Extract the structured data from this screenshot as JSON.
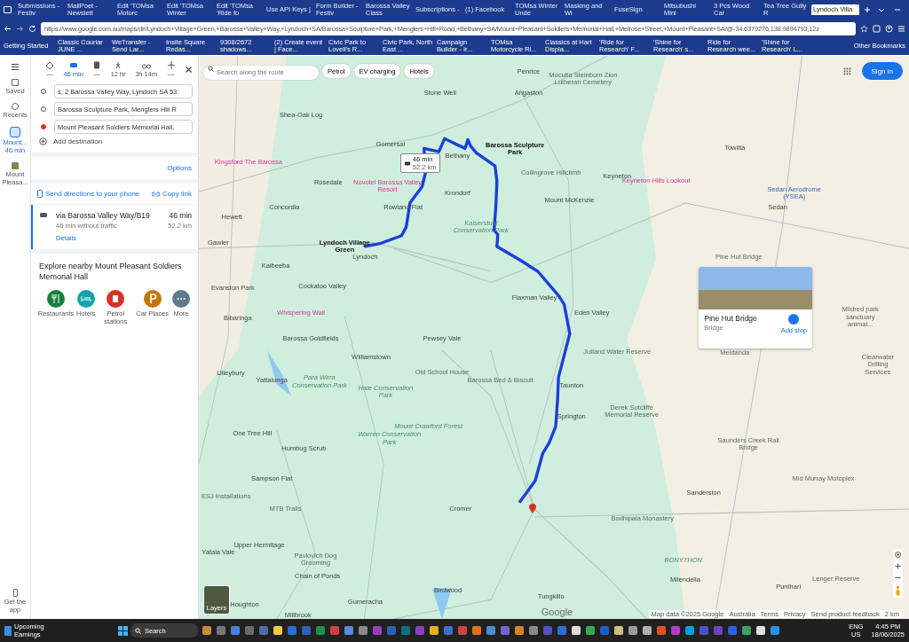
{
  "browser": {
    "tabs": [
      {
        "label": "Submissions - Festiv",
        "selected": false
      },
      {
        "label": "MailPoet - Newslett",
        "selected": false
      },
      {
        "label": "Edit 'TOMsa Motorc",
        "selected": false
      },
      {
        "label": "Edit 'TOMsa Winter",
        "selected": false
      },
      {
        "label": "Edit 'TOMsa 'Ride fo",
        "selected": false
      },
      {
        "label": "Use API Keys |",
        "selected": false
      },
      {
        "label": "Form Builder - Festiv",
        "selected": false
      },
      {
        "label": "Barossa Valley Class",
        "selected": false
      },
      {
        "label": "Subscriptions -",
        "selected": false
      },
      {
        "label": "(1) Facebook",
        "selected": false
      },
      {
        "label": "TOMsa Winter Unde",
        "selected": false
      },
      {
        "label": "Masking and Wi",
        "selected": false
      },
      {
        "label": "FuseSign",
        "selected": false
      },
      {
        "label": "Mitsubushi Mini",
        "selected": false
      },
      {
        "label": "3 Pcs Wood Car",
        "selected": false
      },
      {
        "label": "Tea Tree Gully R",
        "selected": false
      },
      {
        "label": "Lyndoch Villa",
        "selected": true
      }
    ],
    "url": "https://www.google.com.au/maps/dir/Lyndoch+Village+Green,+Barossa+Valley+Way,+Lyndoch+SA/Barossa+Sculpture+Park,+Menglers+Hill+Road,+Bethany+SA/Mount+Pleasant+Soldiers+Memorial+Hall,+Melrose+Street,+Mount+Pleasant+SA/@-34.6379276,138.9894793,12z",
    "bookmarks": [
      "Getting Started",
      "Classic Couriar JUNE ...",
      "WeTransfer - Send Lar...",
      "Insite Square Redas...",
      "9308/2672 shadows...",
      "(2) Create event | Face...",
      "Civic Park to Lovell's R...",
      "Civic Park, North East ...",
      "Campaign Builder - Ir...",
      "TOMsa Motorcycle Ri...",
      "Classics at Hart Displa...",
      "'Ride for Research' F...",
      "'Shine for Research' s...",
      "Ride for Research wee...",
      "'Shine for Research' L..."
    ],
    "other_bookmarks": "Other Bookmarks"
  },
  "rail": {
    "items": [
      {
        "kind": "saved",
        "label": "Saved",
        "selected": false
      },
      {
        "kind": "recents",
        "label": "Recents",
        "selected": false
      },
      {
        "kind": "route",
        "label": "Mount... 46 min",
        "selected": true
      },
      {
        "kind": "place",
        "label": "Mount Pleasa...",
        "selected": false
      }
    ],
    "get_app": "Get the app"
  },
  "directions": {
    "modes": [
      {
        "kind": "best",
        "label": "—",
        "selected": false
      },
      {
        "kind": "car",
        "label": "46 min",
        "selected": true
      },
      {
        "kind": "transit",
        "label": "—",
        "selected": false
      },
      {
        "kind": "walk",
        "label": "12 hr",
        "selected": false
      },
      {
        "kind": "bike",
        "label": "3h 14m",
        "selected": false
      },
      {
        "kind": "flight",
        "label": "—",
        "selected": false
      }
    ],
    "stops": [
      {
        "kind": "start",
        "value": "s, 2 Barossa Valley Way, Lyndoch SA 53:"
      },
      {
        "kind": "via",
        "value": "Barossa Sculpture Park, Menglers Hill R"
      },
      {
        "kind": "end",
        "value": "Mount Pleasant Soldiers Memorial Hall,"
      }
    ],
    "add_destination": "Add destination",
    "options": "Options",
    "send": "Send directions to your phone",
    "copy": "Copy link",
    "route": {
      "name": "via Barossa Valley Way/B19",
      "time": "46 min",
      "note": "46 min without traffic",
      "distance": "52.2 km",
      "details": "Details",
      "selected": true
    },
    "explore_title": "Explore nearby Mount Pleasant Soldiers Memorial Hall",
    "categories": [
      {
        "kind": "food",
        "label": "Restaurants",
        "color": "#188038"
      },
      {
        "kind": "bed",
        "label": "Hotels",
        "color": "#12a4af"
      },
      {
        "kind": "fuel",
        "label": "Petrol stations",
        "color": "#d93025"
      },
      {
        "kind": "parking",
        "label": "Car Places",
        "color": "#c5780a"
      },
      {
        "kind": "more",
        "label": "More",
        "color": "#5f7a8c"
      }
    ]
  },
  "map": {
    "search_placeholder": "Search along the route",
    "chips": [
      "Petrol",
      "EV charging",
      "Hotels"
    ],
    "sign_in": "Sign in",
    "route_badge": {
      "time": "46 min",
      "distance": "52.2 km"
    },
    "labels": [
      {
        "text": "Penrice",
        "kind": "place"
      },
      {
        "text": "Moculta Steinborn Zion Lutheran Cemetery",
        "kind": "landmark"
      },
      {
        "text": "Stone Well",
        "kind": "place"
      },
      {
        "text": "Angaston",
        "kind": "place"
      },
      {
        "text": "Shea-Oak Log",
        "kind": "place"
      },
      {
        "text": "Gomersal",
        "kind": "place"
      },
      {
        "text": "Bethany",
        "kind": "place"
      },
      {
        "text": "Barossa Sculpture Park",
        "kind": "stop"
      },
      {
        "text": "Towitta",
        "kind": "place"
      },
      {
        "text": "Kingsford The Barossa",
        "kind": "hotel"
      },
      {
        "text": "Rosedale",
        "kind": "place"
      },
      {
        "text": "Novotel Barossa Valley Resort",
        "kind": "hotel"
      },
      {
        "text": "Collingrove Hillclimb",
        "kind": "park"
      },
      {
        "text": "Keyneton",
        "kind": "place"
      },
      {
        "text": "Keyneton Hills Lookout",
        "kind": "hotel"
      },
      {
        "text": "Krondorf",
        "kind": "place"
      },
      {
        "text": "Mount McKenzie",
        "kind": "place"
      },
      {
        "text": "Sedan Aerodrome (YSEA)",
        "kind": "airport"
      },
      {
        "text": "Concordia",
        "kind": "place"
      },
      {
        "text": "Rowland Flat",
        "kind": "place"
      },
      {
        "text": "Sedan",
        "kind": "place"
      },
      {
        "text": "Hewett",
        "kind": "place"
      },
      {
        "text": "Kaiserstuhl Conservation Park",
        "kind": "area"
      },
      {
        "text": "Gawler",
        "kind": "place"
      },
      {
        "text": "Lyndoch Village Green",
        "kind": "stop"
      },
      {
        "text": "Lyndoch",
        "kind": "place"
      },
      {
        "text": "Pine Hut Bridge",
        "kind": "landmark"
      },
      {
        "text": "Kalbeeba",
        "kind": "place"
      },
      {
        "text": "Evanston Park",
        "kind": "place"
      },
      {
        "text": "Cockatoo Valley",
        "kind": "place"
      },
      {
        "text": "Flaxman Valley",
        "kind": "place"
      },
      {
        "text": "Bibaringa",
        "kind": "place"
      },
      {
        "text": "Whispering Wall",
        "kind": "hotel"
      },
      {
        "text": "Eden Valley",
        "kind": "place"
      },
      {
        "text": "Mildred park sanctuary animal...",
        "kind": "park"
      },
      {
        "text": "Barossa Goldfields",
        "kind": "place"
      },
      {
        "text": "Pewsey Vale",
        "kind": "place"
      },
      {
        "text": "Williamstown",
        "kind": "place"
      },
      {
        "text": "Jutland Water Reserve",
        "kind": "park"
      },
      {
        "text": "Meldanda",
        "kind": "park"
      },
      {
        "text": "Ulleybury",
        "kind": "place"
      },
      {
        "text": "Yattalunga",
        "kind": "place"
      },
      {
        "text": "Para Wirra Conservation Park",
        "kind": "area"
      },
      {
        "text": "Hale Conservation Park",
        "kind": "area"
      },
      {
        "text": "Old School House",
        "kind": "park"
      },
      {
        "text": "Barossa Bed & Biscuit",
        "kind": "landmark"
      },
      {
        "text": "Taunton",
        "kind": "place"
      },
      {
        "text": "Clearwater Drilling Services",
        "kind": "park"
      },
      {
        "text": "Springton",
        "kind": "place"
      },
      {
        "text": "Derek Sutcliffe Memorial Reserve",
        "kind": "park"
      },
      {
        "text": "Mount Crawford Forest",
        "kind": "area"
      },
      {
        "text": "One Tree Hill",
        "kind": "place"
      },
      {
        "text": "Humbug Scrub",
        "kind": "place"
      },
      {
        "text": "Warren Conservation Park",
        "kind": "area"
      },
      {
        "text": "Saunders Creek Rail Bridge",
        "kind": "landmark"
      },
      {
        "text": "Sampson Flat",
        "kind": "place"
      },
      {
        "text": "Mid Murray Motoplex",
        "kind": "park"
      },
      {
        "text": "ESJ Installations",
        "kind": "landmark"
      },
      {
        "text": "Sanderston",
        "kind": "place"
      },
      {
        "text": "MTB Trails",
        "kind": "park"
      },
      {
        "text": "Cromer",
        "kind": "place"
      },
      {
        "text": "Bodhipala Monastery",
        "kind": "landmark"
      },
      {
        "text": "Yatala Vale",
        "kind": "place"
      },
      {
        "text": "Upper Hermitage",
        "kind": "place"
      },
      {
        "text": "Pavlovich Dog Grooming",
        "kind": "landmark"
      },
      {
        "text": "BONYTHON",
        "kind": "area"
      },
      {
        "text": "Chain of Ponds",
        "kind": "place"
      },
      {
        "text": "Birdwood",
        "kind": "place"
      },
      {
        "text": "Milendella",
        "kind": "place"
      },
      {
        "text": "Punthari",
        "kind": "place"
      },
      {
        "text": "Lenger Reserve",
        "kind": "park"
      },
      {
        "text": "Houghton",
        "kind": "place"
      },
      {
        "text": "Millbrook",
        "kind": "place"
      },
      {
        "text": "Gumeracha",
        "kind": "place"
      },
      {
        "text": "Tungkillo",
        "kind": "place"
      }
    ],
    "card": {
      "title": "Pine Hut Bridge",
      "subtitle": "Bridge",
      "action": "Add stop"
    },
    "layers": "Layers",
    "logo": "Google",
    "footer": [
      "Map data ©2025 Google",
      "Australia",
      "Terms",
      "Privacy",
      "Send product feedback",
      "2 km"
    ]
  },
  "taskbar": {
    "widget_title": "Upcoming",
    "widget_sub": "Earnings",
    "search": "Search",
    "lang": "ENG",
    "region": "US",
    "time": "4:45 PM",
    "date": "18/06/2025"
  }
}
